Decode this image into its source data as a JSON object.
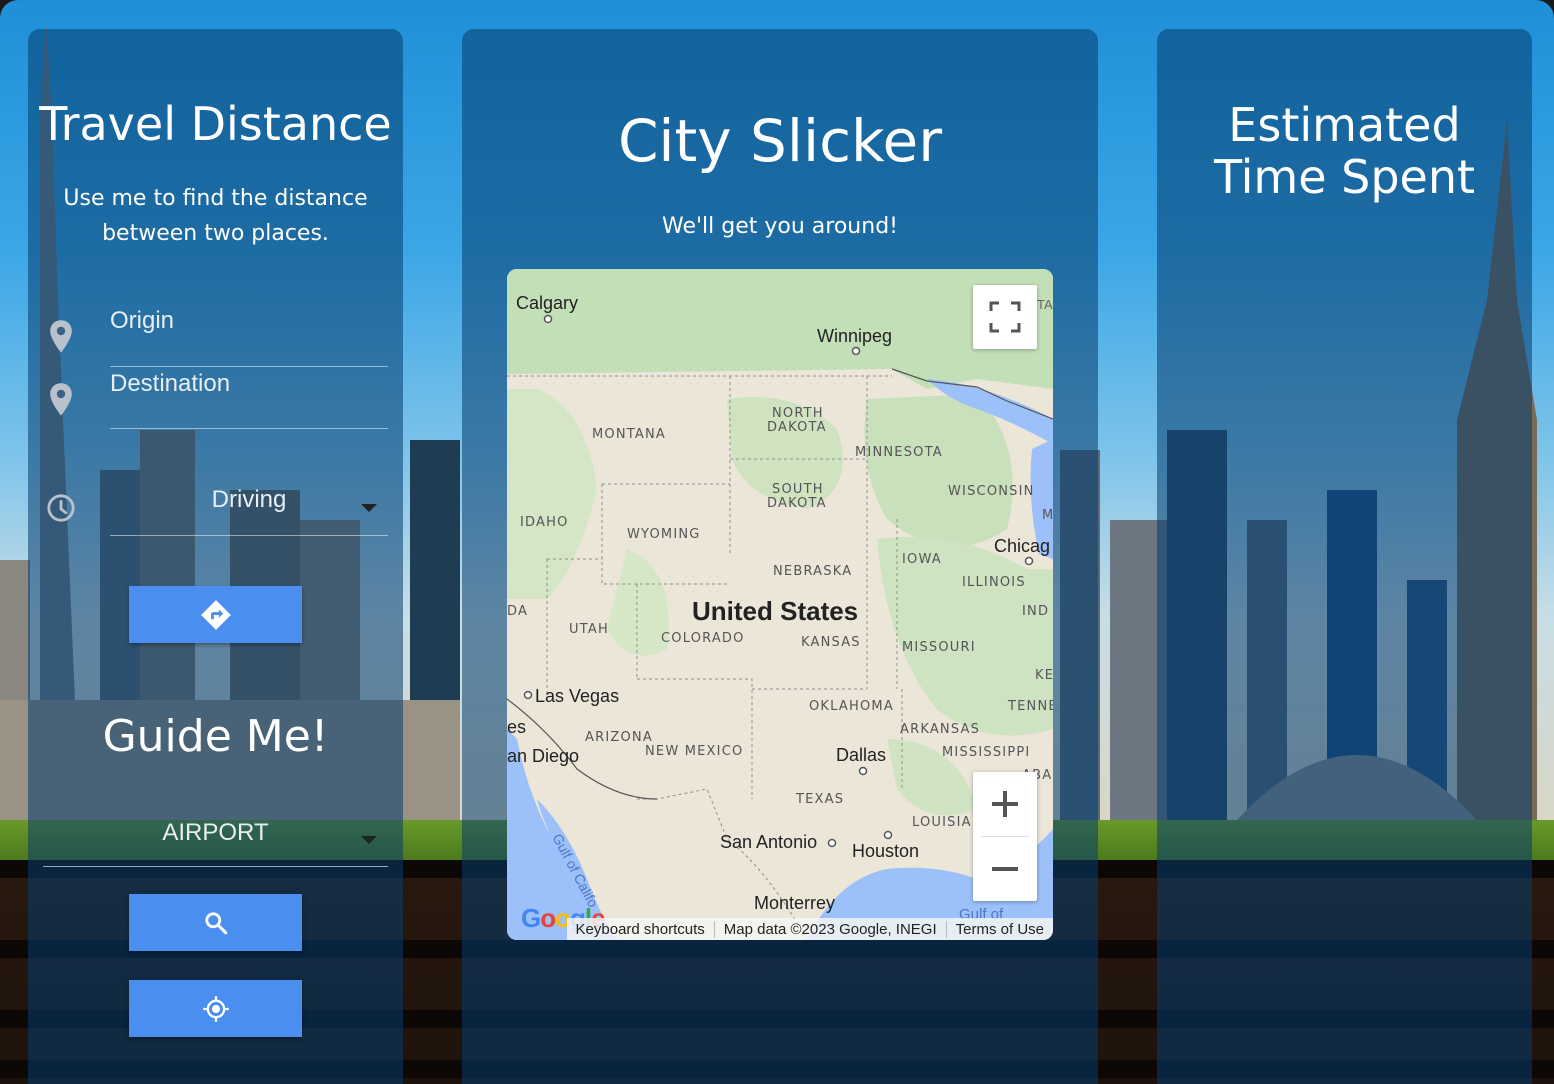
{
  "left_panel": {
    "title": "Travel Distance",
    "subtitle": "Use me to find the distance between two places.",
    "origin_placeholder": "Origin",
    "destination_placeholder": "Destination",
    "travel_mode": "Driving",
    "route_button_icon": "directions-icon",
    "guide_title": "Guide Me!",
    "place_type": "AIRPORT",
    "search_button_icon": "search-icon",
    "locate_button_icon": "my-location-icon"
  },
  "center_panel": {
    "title": "City Slicker",
    "subtitle": "We'll get you around!",
    "map": {
      "labels": {
        "calgary": "Calgary",
        "winnipeg": "Winnipeg",
        "montana": "MONTANA",
        "north_dakota_1": "NORTH",
        "north_dakota_2": "DAKOTA",
        "minnesota": "MINNESOTA",
        "south_dakota_1": "SOUTH",
        "south_dakota_2": "DAKOTA",
        "wisconsin": "WISCONSIN",
        "idaho": "IDAHO",
        "wyoming": "WYOMING",
        "chicago": "Chicag",
        "iowa": "IOWA",
        "nebraska": "NEBRASKA",
        "illinois": "ILLINOIS",
        "ind": "IND",
        "united_states": "United States",
        "utah": "UTAH",
        "colorado": "COLORADO",
        "kansas": "KANSAS",
        "missouri": "MISSOURI",
        "da": "DA",
        "las_vegas": "Las Vegas",
        "oklahoma": "OKLAHOMA",
        "tenne": "TENNE",
        "ke": "KE",
        "es": "es",
        "arizona": "ARIZONA",
        "arkansas": "ARKANSAS",
        "san_diego": "an Diego",
        "new_mexico": "NEW MEXICO",
        "dallas": "Dallas",
        "mississippi": "MISSISSIPPI",
        "texas": "TEXAS",
        "louisiana": "LOUISIA",
        "san_antonio": "San Antonio",
        "houston": "Houston",
        "monterrey": "Monterrey",
        "gulf_of_california": "Gulf of Califo",
        "gulf_of_mexico": "Gulf of",
        "alabama": "ABA",
        "m": "M",
        "ta": "TA"
      },
      "attribution": {
        "shortcuts": "Keyboard shortcuts",
        "map_data": "Map data ©2023 Google, INEGI",
        "terms": "Terms of Use"
      },
      "logo": "Google",
      "zoom_in": "+",
      "zoom_out": "−"
    }
  },
  "right_panel": {
    "title_line1": "Estimated",
    "title_line2": "Time Spent"
  },
  "colors": {
    "panel": "#053c6e",
    "button": "#4a8ff0",
    "map_land": "#e9e4d6",
    "map_green": "#c3dfb8",
    "map_water": "#9cc0f9"
  }
}
